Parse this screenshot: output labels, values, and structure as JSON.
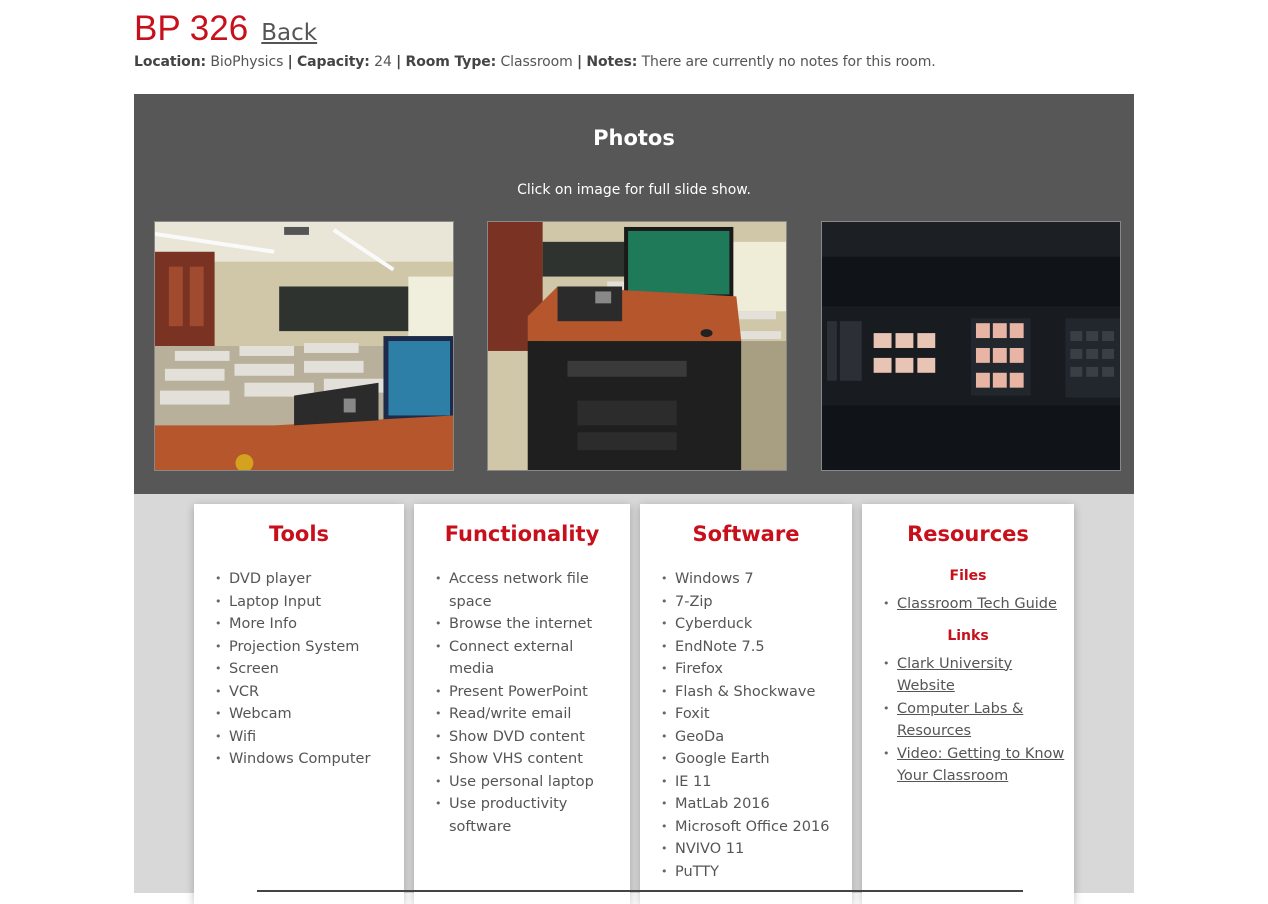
{
  "room": {
    "title": "BP 326",
    "back_label": "Back",
    "location_label": "Location:",
    "location_value": "BioPhysics",
    "capacity_label": "Capacity:",
    "capacity_value": "24",
    "room_type_label": "Room Type:",
    "room_type_value": "Classroom",
    "notes_label": "Notes:",
    "notes_value": "There are currently no notes for this room.",
    "separator": "|"
  },
  "photos": {
    "heading": "Photos",
    "caption": "Click on image for full slide show.",
    "images": [
      {
        "name": "classroom-desks-photo"
      },
      {
        "name": "podium-computer-photo"
      },
      {
        "name": "av-control-panel-photo"
      }
    ]
  },
  "tools": {
    "heading": "Tools",
    "items": [
      "DVD player",
      "Laptop Input",
      "More Info",
      "Projection System",
      "Screen",
      "VCR",
      "Webcam",
      "Wifi",
      "Windows Computer"
    ]
  },
  "functionality": {
    "heading": "Functionality",
    "items": [
      "Access network file space",
      "Browse the internet",
      "Connect external media",
      "Present PowerPoint",
      "Read/write email",
      "Show DVD content",
      "Show VHS content",
      "Use personal laptop",
      "Use productivity software"
    ]
  },
  "software": {
    "heading": "Software",
    "items": [
      "Windows 7",
      "7-Zip",
      "Cyberduck",
      "EndNote 7.5",
      "Firefox",
      "Flash & Shockwave",
      "Foxit",
      "GeoDa",
      "Google Earth",
      "IE 11",
      "MatLab 2016",
      "Microsoft Office 2016",
      "NVIVO 11",
      "PuTTY"
    ]
  },
  "resources": {
    "heading": "Resources",
    "files_heading": "Files",
    "files": [
      "Classroom Tech Guide"
    ],
    "links_heading": "Links",
    "links": [
      "Clark University Website",
      "Computer Labs & Resources",
      "Video: Getting to Know Your Classroom"
    ]
  },
  "colors": {
    "accent": "#c8101c",
    "photos_bg": "#575757",
    "cards_bg": "#d8d8d8"
  }
}
